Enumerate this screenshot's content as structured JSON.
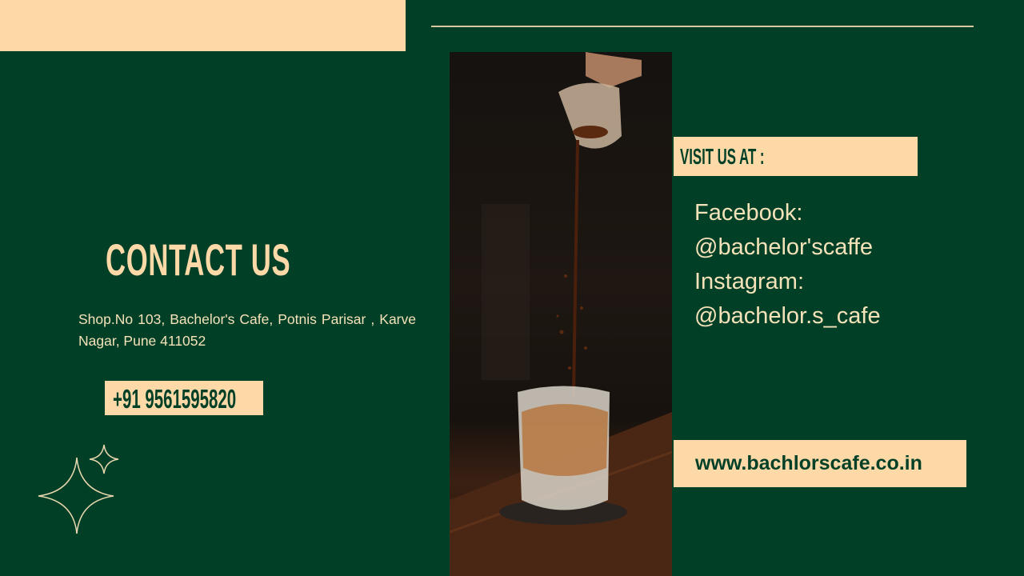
{
  "heading": "CONTACT US",
  "address": "Shop.No 103, Bachelor's Cafe, Potnis  Parisar , Karve Nagar, Pune 411052",
  "phone": "+91 9561595820",
  "visit_label": "VISIT US AT :",
  "social": {
    "facebook_label": "Facebook:",
    "facebook_handle": "@bachelor'scaffe",
    "instagram_label": "Instagram:",
    "instagram_handle": "@bachelor.s_cafe"
  },
  "website": "www.bachlorscafe.co.in",
  "colors": {
    "background": "#013f27",
    "accent": "#fdd9a8"
  }
}
